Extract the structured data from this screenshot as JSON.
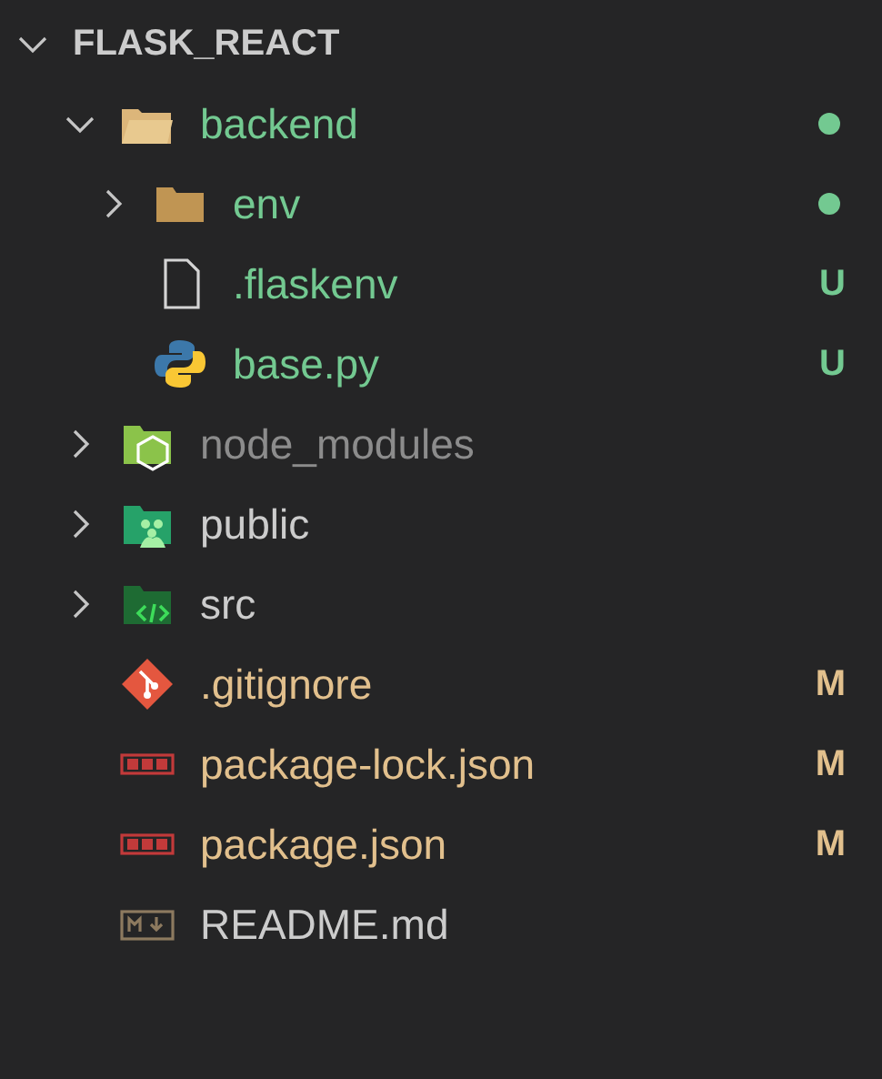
{
  "root": {
    "name": "FLASK_REACT",
    "expanded": true,
    "children": [
      {
        "name": "backend",
        "kind": "folder",
        "expanded": true,
        "color": "#73c991",
        "dot": true,
        "children": [
          {
            "name": "env",
            "kind": "folder",
            "expanded": false,
            "color": "#73c991",
            "dot": true
          },
          {
            "name": ".flaskenv",
            "kind": "file",
            "color": "#73c991",
            "badge": "U"
          },
          {
            "name": "base.py",
            "kind": "python",
            "color": "#73c991",
            "badge": "U"
          }
        ]
      },
      {
        "name": "node_modules",
        "kind": "node",
        "expanded": false,
        "color": "#8c8c8c",
        "dot": false
      },
      {
        "name": "public",
        "kind": "people",
        "expanded": false,
        "color": "#cccccc",
        "dot": false
      },
      {
        "name": "src",
        "kind": "code",
        "expanded": false,
        "color": "#cccccc",
        "dot": false
      },
      {
        "name": ".gitignore",
        "kind": "git",
        "color": "#e2c08d",
        "badge": "M"
      },
      {
        "name": "package-lock.json",
        "kind": "npm",
        "color": "#e2c08d",
        "badge": "M"
      },
      {
        "name": "package.json",
        "kind": "npm",
        "color": "#e2c08d",
        "badge": "M"
      },
      {
        "name": "README.md",
        "kind": "markdown",
        "color": "#cccccc"
      }
    ]
  }
}
